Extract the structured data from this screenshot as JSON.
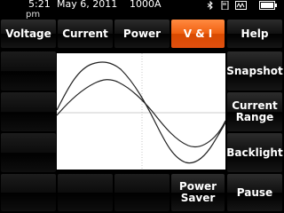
{
  "status": {
    "time": "5:21",
    "ampm": "pm",
    "date": "May 6, 2011",
    "range": "1000A",
    "icons": [
      "bluetooth-icon",
      "sd-card-icon",
      "memory-icon",
      "battery-icon"
    ]
  },
  "tabs": [
    {
      "label": "Voltage",
      "active": false
    },
    {
      "label": "Current",
      "active": false
    },
    {
      "label": "Power",
      "active": false
    },
    {
      "label": "V & I",
      "active": true
    },
    {
      "label": "Help",
      "active": false
    }
  ],
  "right_buttons": [
    "Snapshot",
    "Current\nRange",
    "Backlight",
    "Pause"
  ],
  "bottom_buttons": [
    "Power\nSaver"
  ],
  "colors": {
    "accent": "#f06010",
    "plot_bg": "#ffffff",
    "waveform": "#222222"
  }
}
